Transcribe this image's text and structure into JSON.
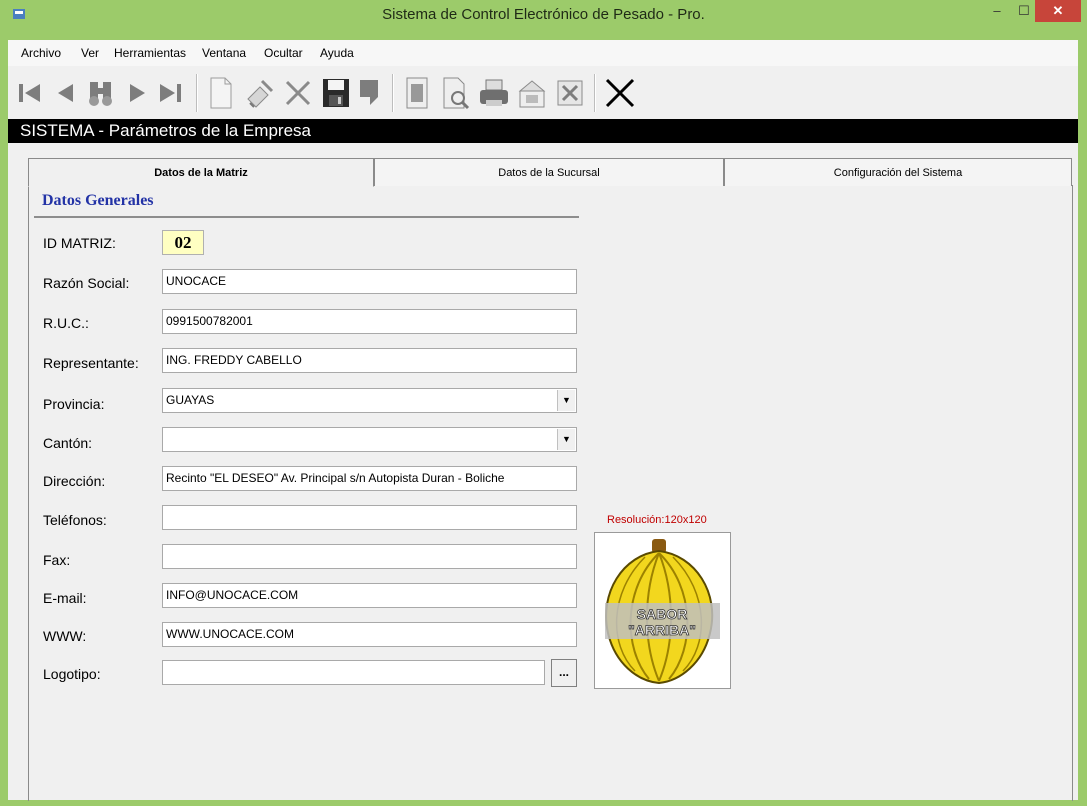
{
  "window": {
    "title": "Sistema de Control Electrónico de Pesado - Pro."
  },
  "menu": [
    "Archivo",
    "Ver",
    "Herramientas",
    "Ventana",
    "Ocultar",
    "Ayuda"
  ],
  "toolbar": {
    "buttons": [
      "first-record-icon",
      "previous-record-icon",
      "search-icon",
      "next-record-icon",
      "last-record-icon",
      "new-document-icon",
      "edit-icon",
      "delete-icon",
      "save-icon",
      "undo-icon",
      "report-icon",
      "preview-icon",
      "print-icon",
      "export-icon",
      "excel-icon",
      "exit-icon"
    ]
  },
  "header": {
    "title": "SISTEMA - Parámetros de la Empresa"
  },
  "tabs": [
    "Datos de la Matriz",
    "Datos de la Sucursal",
    "Configuración del Sistema"
  ],
  "section": {
    "title": "Datos Generales"
  },
  "form": {
    "id_label": "ID MATRIZ:",
    "id_value": "02",
    "razon_label": "Razón Social:",
    "razon_value": "UNOCACE",
    "ruc_label": "R.U.C.:",
    "ruc_value": "0991500782001",
    "rep_label": "Representante:",
    "rep_value": "ING. FREDDY CABELLO",
    "prov_label": "Provincia:",
    "prov_value": "GUAYAS",
    "canton_label": "Cantón:",
    "canton_value": "",
    "dir_label": "Dirección:",
    "dir_value": "Recinto \"EL DESEO\" Av. Principal s/n Autopista Duran - Boliche",
    "tel_label": "Teléfonos:",
    "tel_value": "",
    "fax_label": "Fax:",
    "fax_value": "",
    "email_label": "E-mail:",
    "email_value": "INFO@UNOCACE.COM",
    "www_label": "WWW:",
    "www_value": "WWW.UNOCACE.COM",
    "logo_label": "Logotipo:",
    "logo_value": "",
    "browse_label": "..."
  },
  "logo": {
    "resolution_label": "Resolución:120x120",
    "text_line1": "SABOR",
    "text_line2": "\"ARRIBA\""
  },
  "colors": {
    "window_frame": "#9ccb6a",
    "section_title": "#2333a6",
    "id_box": "#ffffc2",
    "resolution": "#c00000",
    "close_button": "#c7453a"
  }
}
